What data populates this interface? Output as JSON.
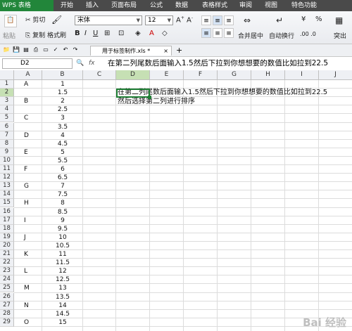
{
  "app": {
    "logo_label": "WPS 表格"
  },
  "menu": [
    "开始",
    "插入",
    "页面布局",
    "公式",
    "数据",
    "表格样式",
    "审阅",
    "视图",
    "特色功能"
  ],
  "ribbon": {
    "paste": "粘贴",
    "cut": "剪切",
    "copy": "复制",
    "format_painter": "格式刷",
    "font_name": "宋体",
    "font_size": "12",
    "merge_center": "合并居中",
    "wrap_text": "自动换行",
    "percent": "%",
    "highlight": "突出"
  },
  "quickbar": {
    "file_tab": "用于标签制作.xls *",
    "new_tab": "+"
  },
  "formula_bar": {
    "name_box": "D2",
    "fx": "fx",
    "content": "在第二列尾数后面输入1.5然后下拉到你想想要的数值比如拉到22.5"
  },
  "columns": [
    "A",
    "B",
    "C",
    "D",
    "E",
    "F",
    "G",
    "H",
    "I",
    "J"
  ],
  "selected": {
    "column": "D",
    "row": "2"
  },
  "rows": [
    {
      "n": "1",
      "a": "A",
      "b": "1"
    },
    {
      "n": "2",
      "a": "",
      "b": "1.5"
    },
    {
      "n": "3",
      "a": "B",
      "b": "2"
    },
    {
      "n": "4",
      "a": "",
      "b": "2.5"
    },
    {
      "n": "5",
      "a": "C",
      "b": "3"
    },
    {
      "n": "6",
      "a": "",
      "b": "3.5"
    },
    {
      "n": "7",
      "a": "D",
      "b": "4"
    },
    {
      "n": "8",
      "a": "",
      "b": "4.5"
    },
    {
      "n": "9",
      "a": "E",
      "b": "5"
    },
    {
      "n": "10",
      "a": "",
      "b": "5.5"
    },
    {
      "n": "11",
      "a": "F",
      "b": "6"
    },
    {
      "n": "12",
      "a": "",
      "b": "6.5"
    },
    {
      "n": "13",
      "a": "G",
      "b": "7"
    },
    {
      "n": "14",
      "a": "",
      "b": "7.5"
    },
    {
      "n": "15",
      "a": "H",
      "b": "8"
    },
    {
      "n": "16",
      "a": "",
      "b": "8.5"
    },
    {
      "n": "17",
      "a": "I",
      "b": "9"
    },
    {
      "n": "18",
      "a": "",
      "b": "9.5"
    },
    {
      "n": "19",
      "a": "J",
      "b": "10"
    },
    {
      "n": "20",
      "a": "",
      "b": "10.5"
    },
    {
      "n": "21",
      "a": "K",
      "b": "11"
    },
    {
      "n": "22",
      "a": "",
      "b": "11.5"
    },
    {
      "n": "23",
      "a": "L",
      "b": "12"
    },
    {
      "n": "24",
      "a": "",
      "b": "12.5"
    },
    {
      "n": "25",
      "a": "M",
      "b": "13"
    },
    {
      "n": "26",
      "a": "",
      "b": "13.5"
    },
    {
      "n": "27",
      "a": "N",
      "b": "14"
    },
    {
      "n": "28",
      "a": "",
      "b": "14.5"
    },
    {
      "n": "29",
      "a": "O",
      "b": "15"
    }
  ],
  "sheet_note": {
    "line1": "在第二列尾数后面输入1.5然后下拉到你想想要的数值比如拉到22.5",
    "line2": "然后选择第二列进行排序"
  },
  "watermark": "Bai 经验"
}
